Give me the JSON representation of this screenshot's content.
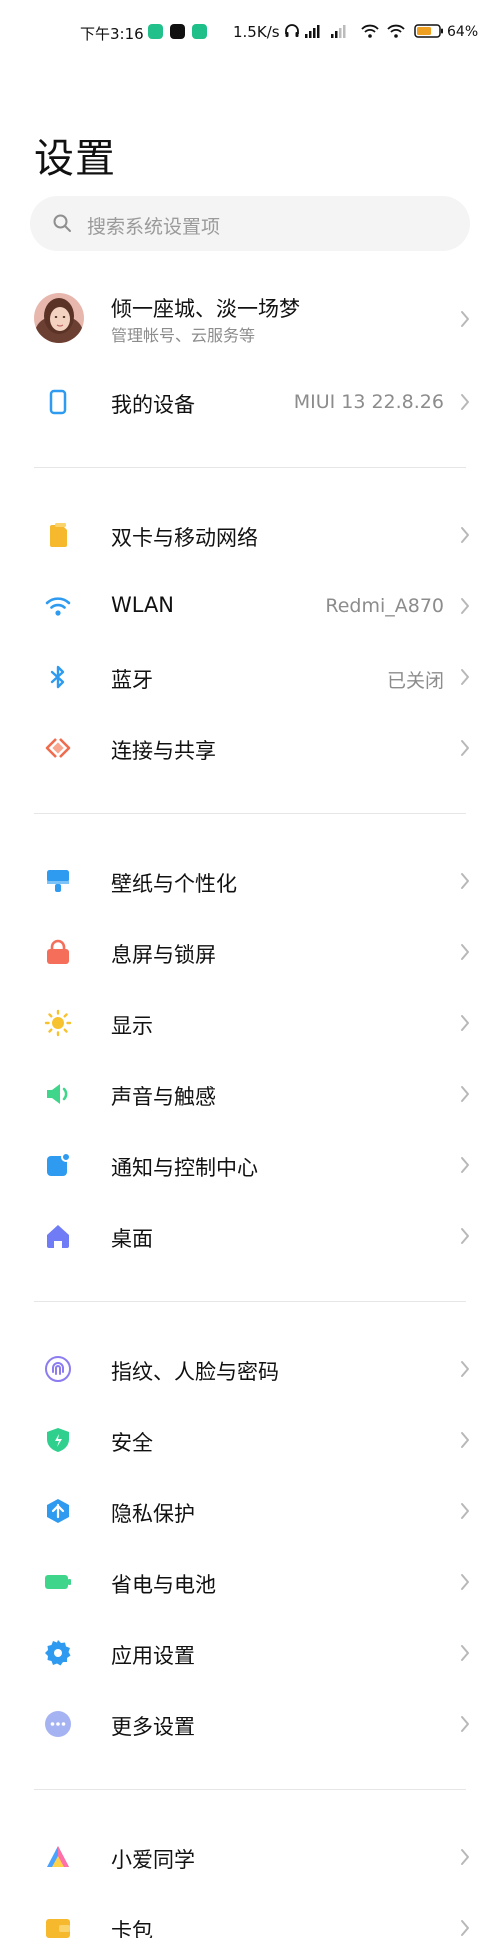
{
  "status_bar": {
    "time": "下午3:16",
    "speed": "1.5K/s",
    "battery": "64%"
  },
  "page_title": "设置",
  "search": {
    "placeholder": "搜索系统设置项"
  },
  "profile": {
    "name": "倾一座城、淡一场梦",
    "subtitle": "管理帐号、云服务等"
  },
  "my_device": {
    "label": "我的设备",
    "value": "MIUI 13 22.8.26"
  },
  "sections": [
    [
      {
        "label": "双卡与移动网络",
        "icon": "sim-card-icon",
        "color": "#f6b82d"
      },
      {
        "label": "WLAN",
        "value": "Redmi_A870",
        "icon": "wifi-icon",
        "color": "#2e9bf0"
      },
      {
        "label": "蓝牙",
        "value": "已关闭",
        "icon": "bluetooth-icon",
        "color": "#2e9bf0"
      },
      {
        "label": "连接与共享",
        "icon": "connection-share-icon",
        "color": "#f06b4e"
      }
    ],
    [
      {
        "label": "壁纸与个性化",
        "icon": "wallpaper-icon",
        "color": "#2e9bf0"
      },
      {
        "label": "息屏与锁屏",
        "icon": "lock-icon",
        "color": "#f46e5a"
      },
      {
        "label": "显示",
        "icon": "sun-icon",
        "color": "#f7c22f"
      },
      {
        "label": "声音与触感",
        "icon": "speaker-icon",
        "color": "#3fd68b"
      },
      {
        "label": "通知与控制中心",
        "icon": "notification-icon",
        "color": "#2e9bf0"
      },
      {
        "label": "桌面",
        "icon": "home-icon",
        "color": "#6f7cf5"
      }
    ],
    [
      {
        "label": "指纹、人脸与密码",
        "icon": "fingerprint-icon",
        "color": "#8b7cf0"
      },
      {
        "label": "安全",
        "icon": "shield-icon",
        "color": "#2fcf8e"
      },
      {
        "label": "隐私保护",
        "icon": "privacy-icon",
        "color": "#2e9bf0"
      },
      {
        "label": "省电与电池",
        "icon": "battery-icon",
        "color": "#3fd68b"
      },
      {
        "label": "应用设置",
        "icon": "gear-icon",
        "color": "#2e9bf0"
      },
      {
        "label": "更多设置",
        "icon": "more-icon",
        "color": "#a6b3f2"
      }
    ],
    [
      {
        "label": "小爱同学",
        "icon": "xiaoai-icon",
        "color": "#4aa3ff"
      },
      {
        "label": "卡包",
        "icon": "wallet-icon",
        "color": "#f6b82d"
      }
    ]
  ]
}
